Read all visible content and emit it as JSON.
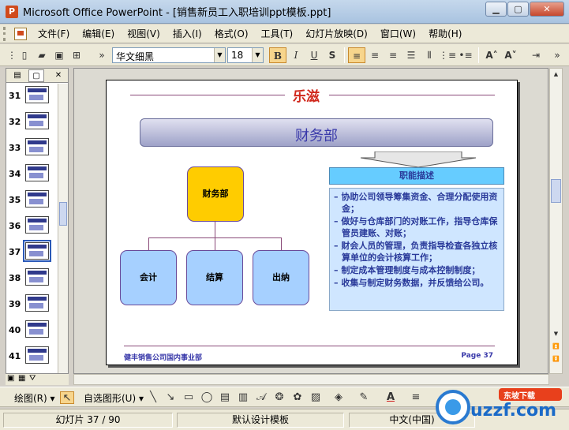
{
  "window": {
    "title": "Microsoft Office PowerPoint - [销售新员工入职培训ppt模板.ppt]",
    "app_icon": "P"
  },
  "menu": [
    "文件(F)",
    "编辑(E)",
    "视图(V)",
    "插入(I)",
    "格式(O)",
    "工具(T)",
    "幻灯片放映(D)",
    "窗口(W)",
    "帮助(H)"
  ],
  "toolbar": {
    "font_name": "华文细黑",
    "font_size": "18",
    "bold": "B",
    "italic": "I",
    "underline": "U",
    "shadow": "S"
  },
  "thumbnails": [
    {
      "num": "31"
    },
    {
      "num": "32"
    },
    {
      "num": "33"
    },
    {
      "num": "34"
    },
    {
      "num": "35"
    },
    {
      "num": "36"
    },
    {
      "num": "37",
      "selected": true
    },
    {
      "num": "38"
    },
    {
      "num": "39"
    },
    {
      "num": "40"
    },
    {
      "num": "41"
    }
  ],
  "slide": {
    "logo": "乐滋",
    "title": "财务部",
    "org": {
      "parent": "财务部",
      "children": [
        "会计",
        "结算",
        "出纳"
      ]
    },
    "description_header": "职能描述",
    "description_items": [
      "– 协助公司领导筹集资金、合理分配使用资金；",
      "– 做好与仓库部门的对账工作，指导仓库保管员建账、对账；",
      "– 财会人员的管理，负责指导检查各独立核算单位的会计核算工作；",
      "– 制定成本管理制度与成本控制制度；",
      "– 收集与制定财务数据，并反馈给公司。"
    ],
    "footer_left": "健丰销售公司国内事业部",
    "footer_right": "Page 37"
  },
  "drawbar": {
    "draw_label": "绘图(R) ▾",
    "autoshape_label": "自选图形(U) ▾"
  },
  "status": {
    "slide_info": "幻灯片 37 / 90",
    "design": "默认设计模板",
    "language": "中文(中国)"
  },
  "watermark": {
    "text": "uzzf.com",
    "sub": "东坡下载"
  },
  "colors": {
    "accent": "#3a3aaa",
    "org_parent": "#ffcc00",
    "org_child": "#a6d0ff",
    "desc_header": "#66ccff"
  }
}
